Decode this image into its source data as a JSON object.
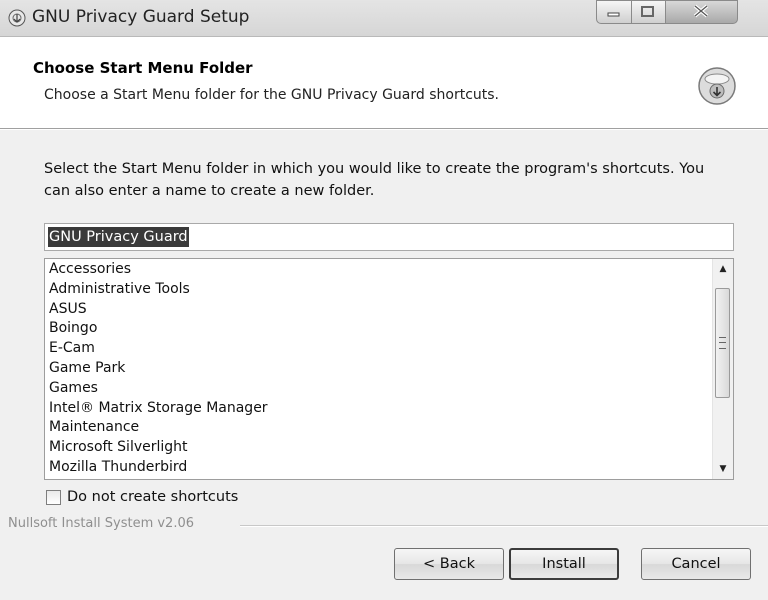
{
  "window": {
    "title": "GNU Privacy Guard Setup"
  },
  "header": {
    "title": "Choose Start Menu Folder",
    "subtitle": "Choose a Start Menu folder for the GNU Privacy Guard shortcuts."
  },
  "body": {
    "description": "Select the Start Menu folder in which you would like to create the program's shortcuts. You can also enter a name to create a new folder.",
    "folder_value": "GNU Privacy Guard",
    "folders": [
      "Accessories",
      "Administrative Tools",
      "ASUS",
      "Boingo",
      "E-Cam",
      "Game Park",
      "Games",
      "Intel® Matrix Storage Manager",
      "Maintenance",
      "Microsoft Silverlight",
      "Mozilla Thunderbird"
    ],
    "no_shortcuts_label": "Do not create shortcuts",
    "no_shortcuts_checked": false
  },
  "footer": {
    "branding": "Nullsoft Install System v2.06",
    "back_label": "< Back",
    "install_label": "Install",
    "cancel_label": "Cancel"
  },
  "icons": {
    "title": "installer-icon",
    "header": "install-disk-icon",
    "minimize": "minimize-icon",
    "maximize": "maximize-icon",
    "close": "close-icon"
  }
}
